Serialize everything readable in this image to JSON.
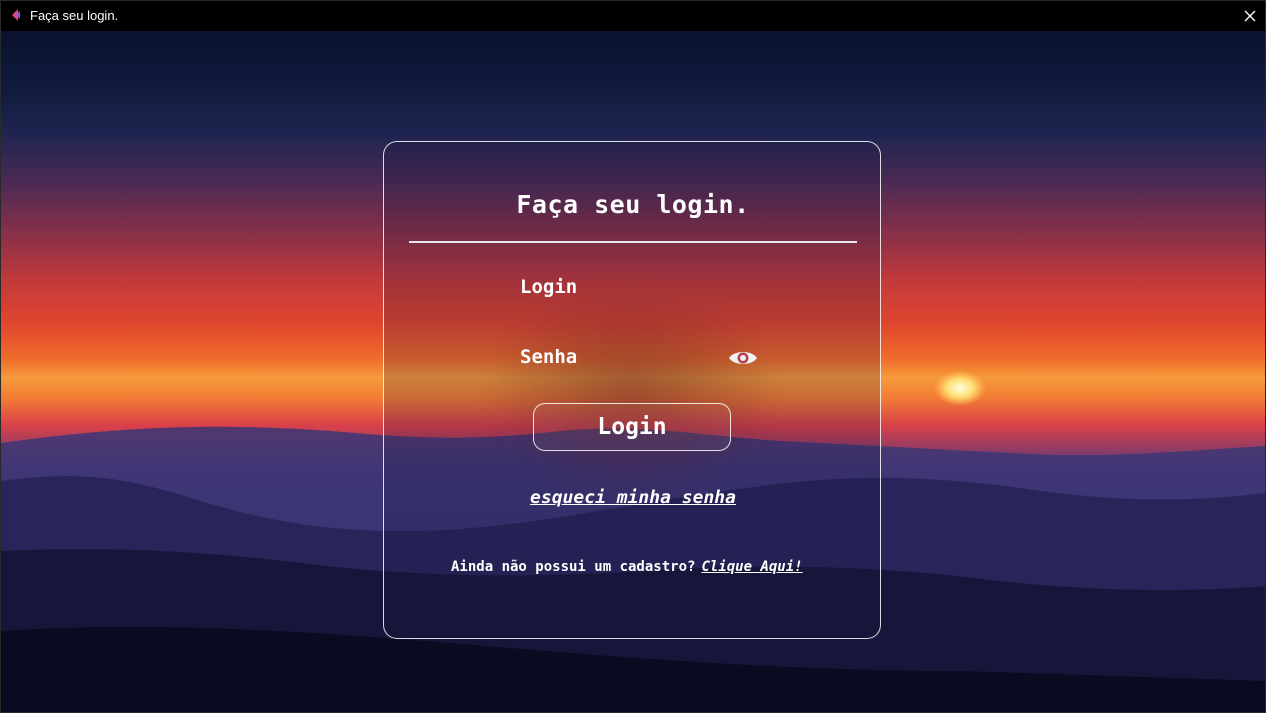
{
  "window": {
    "title": "Faça seu login.",
    "app_icon": "app-logo-icon",
    "close_icon": "close-icon"
  },
  "form": {
    "heading": "Faça seu login.",
    "login_label": "Login",
    "password_label": "Senha",
    "password_toggle_icon": "eye-icon",
    "submit_label": "Login",
    "forgot_link": "esqueci minha senha",
    "signup_prompt": "Ainda não possui um cadastro?",
    "signup_link": "Clique Aqui!"
  },
  "colors": {
    "text": "#ffffff",
    "titlebar": "#000000",
    "accent_icon": "#e0457b"
  }
}
